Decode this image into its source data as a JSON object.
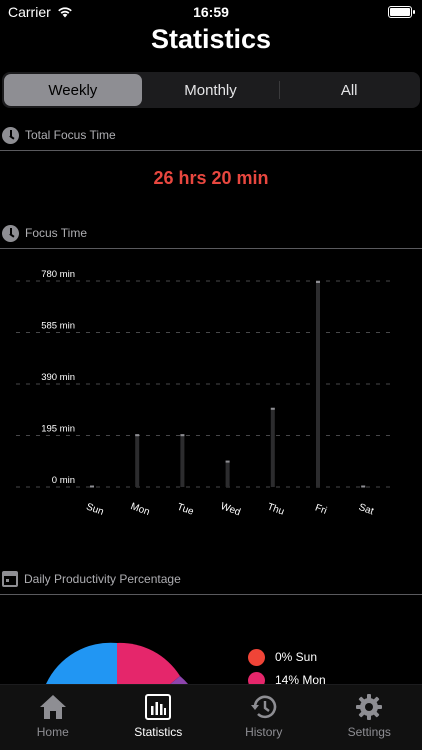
{
  "status": {
    "carrier": "Carrier",
    "time": "16:59"
  },
  "title": "Statistics",
  "segments": [
    {
      "label": "Weekly",
      "active": true
    },
    {
      "label": "Monthly",
      "active": false
    },
    {
      "label": "All",
      "active": false
    }
  ],
  "total_focus": {
    "label": "Total Focus Time",
    "value": "26 hrs 20 min"
  },
  "focus_time": {
    "label": "Focus Time"
  },
  "chart_data": {
    "type": "bar",
    "categories": [
      "Sun",
      "Mon",
      "Tue",
      "Wed",
      "Thu",
      "Fri",
      "Sat"
    ],
    "values": [
      0,
      200,
      200,
      100,
      300,
      780,
      0
    ],
    "yticks": [
      0,
      195,
      390,
      585,
      780
    ],
    "ytick_labels": [
      "0 min",
      "195 min",
      "390 min",
      "585 min",
      "780 min"
    ],
    "ylim": [
      0,
      780
    ],
    "grid": true,
    "bar_color": "#2c2c2e"
  },
  "productivity": {
    "label": "Daily Productivity Percentage",
    "legend": [
      {
        "label": "0% Sun",
        "color": "#f04437"
      },
      {
        "label": "14% Mon",
        "color": "#e5266b"
      }
    ]
  },
  "tabs": [
    {
      "label": "Home",
      "icon": "home-icon",
      "active": false
    },
    {
      "label": "Statistics",
      "icon": "chart-icon",
      "active": true
    },
    {
      "label": "History",
      "icon": "history-icon",
      "active": false
    },
    {
      "label": "Settings",
      "icon": "gear-icon",
      "active": false
    }
  ]
}
